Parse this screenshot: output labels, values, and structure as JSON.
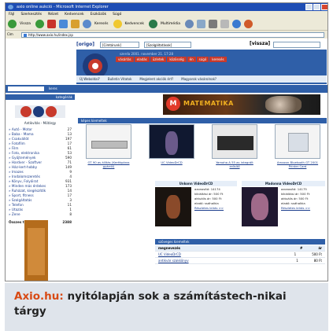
{
  "browser": {
    "title": "axio online aukció - Microsoft Internet Explorer",
    "menu": [
      "Fájl",
      "Szerkesztés",
      "Nézet",
      "Kedvencek",
      "Eszközök",
      "Súgó"
    ],
    "toolbar": {
      "back": "Vissza",
      "search": "Keresés",
      "favorites": "Kedvencek",
      "media": "Multimédia"
    },
    "address": "http://www.axio.hu/index.jsp"
  },
  "origo": {
    "logo": "[origo]",
    "select1": "[Címtárunk]",
    "select2": "[Szolgáltatások]",
    "go": "[vissza]"
  },
  "site": {
    "date": "szerda 2001. november 21. 17:28",
    "nav": [
      "vásárlás",
      "eladás",
      "üzletek",
      "közösség",
      "én",
      "súgó",
      "keresés"
    ],
    "subnav": [
      "Új Weboldal?",
      "Bulletin Vitatok",
      "Megjelent akciók ért?",
      "Magyarok vásárolnak?"
    ],
    "search_btn": "keres",
    "categories_head": "kategóriák",
    "logo_sub": "Antikvitás - Műtárgy"
  },
  "categories": [
    {
      "name": "Autó - Motor",
      "count": "27"
    },
    {
      "name": "Baba - Mama",
      "count": "13"
    },
    {
      "name": "Csakvállót",
      "count": "197"
    },
    {
      "name": "Fotofilm",
      "count": "17"
    },
    {
      "name": "Film",
      "count": "61"
    },
    {
      "name": "Foto, elektronika",
      "count": "53"
    },
    {
      "name": "Gyűjtemények",
      "count": "590"
    },
    {
      "name": "Hardver - Szoftver",
      "count": "71"
    },
    {
      "name": "Ház-kert-hobby",
      "count": "149"
    },
    {
      "name": "Imazes",
      "count": "9"
    },
    {
      "name": "Irodalomszeretés",
      "count": "4"
    },
    {
      "name": "Könyv, Folyóirat",
      "count": "931"
    },
    {
      "name": "Minden más érdekes",
      "count": "173"
    },
    {
      "name": "Ruházat, kiegészítők",
      "count": "14"
    },
    {
      "name": "Sport, fitness",
      "count": "17"
    },
    {
      "name": "Szolgáltatás",
      "count": "3"
    },
    {
      "name": "Telefon",
      "count": "11"
    },
    {
      "name": "Utazás",
      "count": "1"
    },
    {
      "name": "Zene",
      "count": "8"
    }
  ],
  "total": {
    "label": "Összes tárgy:",
    "value": "2388"
  },
  "banner": {
    "letter": "M",
    "text": "MATEMATIKA"
  },
  "featured": {
    "head": "képes kiemeltek",
    "items": [
      {
        "caption": "GT 90 as állítás (Kerékpáros gyárról)"
      },
      {
        "caption": "UC VideoDrCD"
      },
      {
        "caption": "Yamaha A 55 as integrált erősítő"
      },
      {
        "caption": "Amazon Bluetooth GT 2001 Printer Card"
      }
    ]
  },
  "video": {
    "left_head": "Unkonn VideoDrCD",
    "right_head": "Madonna VideoDrCD",
    "left_rows": [
      "azonosító: 14174",
      "kikiáltási ár: 500 Ft",
      "aktuális ár: 500 Ft",
      "eladó: ssdhalkia"
    ],
    "right_rows": [
      "azonosító: 14175",
      "kikiáltási ár: 500 Ft",
      "aktuális ár: 500 Ft",
      "eladó: ssdhalkia"
    ],
    "details": "Részletes leírás >>"
  },
  "text_featured": {
    "head": "szöveges kiemeltek",
    "columns": [
      "megnevezés",
      "#",
      "ár"
    ],
    "rows": [
      {
        "name": "UC VideoDrCD",
        "count": "1",
        "price": "500 Ft"
      },
      {
        "name": "antikvár szakkönyv",
        "count": "1",
        "price": "80 Ft"
      }
    ]
  },
  "caption": {
    "highlight": "Axio.hu:",
    "text": " nyitólapján sok a számítástech-nikai tárgy"
  }
}
